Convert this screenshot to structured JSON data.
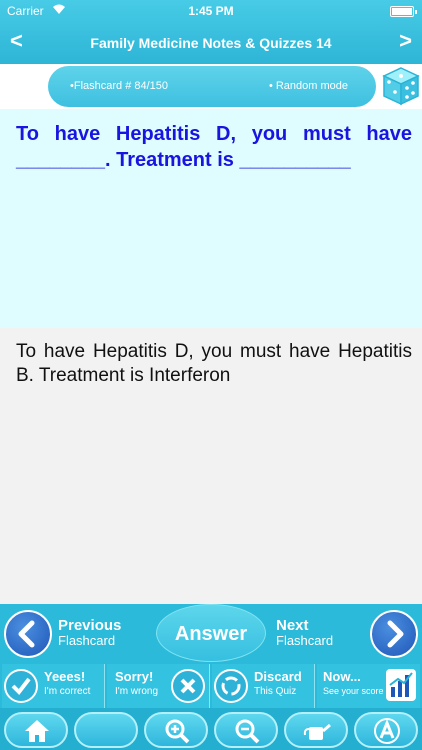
{
  "status_bar": {
    "carrier": "Carrier",
    "time": "1:45 PM"
  },
  "nav": {
    "title": "Family Medicine Notes & Quizzes 14",
    "back_glyph": "<",
    "forward_glyph": ">"
  },
  "info": {
    "flashcard_label": "•Flashcard #  84/150",
    "mode_label": "• Random mode"
  },
  "question": "To have Hepatitis D, you must have ________. Treatment is __________",
  "answer": "To have Hepatitis D, you must have Hepatitis B. Treatment is Interferon",
  "controls": {
    "previous": {
      "line1": "Previous",
      "line2": "Flashcard"
    },
    "answer_label": "Answer",
    "next": {
      "line1": "Next",
      "line2": "Flashcard"
    },
    "actions": [
      {
        "line1": "Yeees!",
        "line2": "I'm correct"
      },
      {
        "line1": "Sorry!",
        "line2": "I'm wrong"
      },
      {
        "line1": "Discard",
        "line2": "This Quiz"
      },
      {
        "line1": "Now...",
        "line2": "See your score"
      }
    ],
    "tools": [
      "home-icon",
      "blank",
      "zoom-in-icon",
      "zoom-out-icon",
      "watering-can-icon",
      "font-icon"
    ]
  },
  "colors": {
    "header": "#2eb5d6",
    "question_bg": "#dffcff",
    "question_text": "#1a14e0",
    "accent_blue": "#1f57b8"
  }
}
